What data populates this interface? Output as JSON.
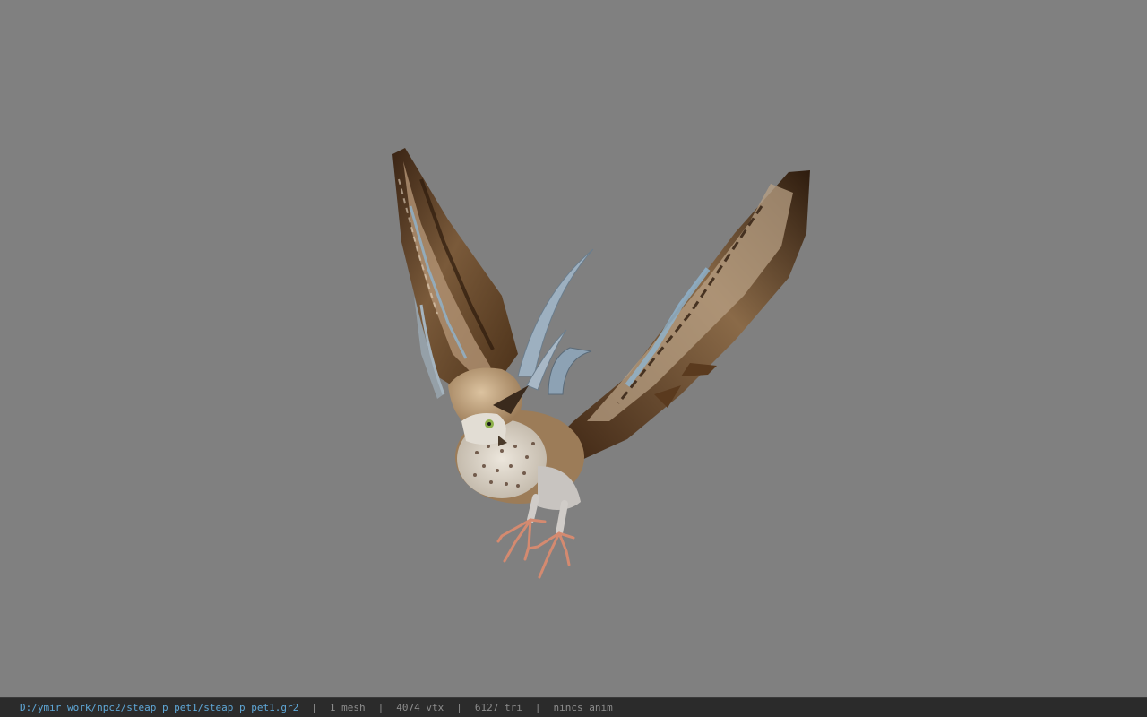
{
  "viewport": {
    "background_color": "#808080",
    "model": "owl-pet-model"
  },
  "status_bar": {
    "file_path": "D:/ymir work/npc2/steap_p_pet1/steap_p_pet1.gr2",
    "separator": "|",
    "mesh_count": "1 mesh",
    "vertex_count": "4074 vtx",
    "triangle_count": "6127 tri",
    "animation": "nincs anim",
    "path_color": "#5fa8d8",
    "text_color": "#8c8c8c"
  }
}
